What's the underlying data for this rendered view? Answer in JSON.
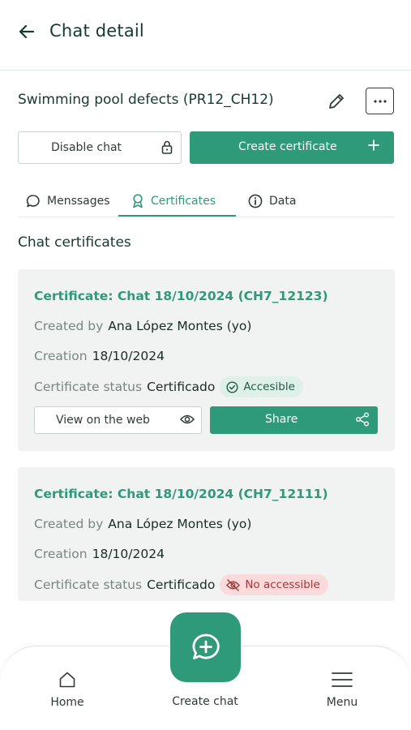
{
  "header": {
    "title": "Chat detail",
    "back_icon": "arrow-left-icon"
  },
  "chat": {
    "title": "Swimming pool defects (PR12_CH12)",
    "disable_label": "Disable chat",
    "create_certificate_label": "Create certificate"
  },
  "tabs": [
    {
      "label": "Menssages",
      "icon": "chat-bubble-icon"
    },
    {
      "label": "Certificates",
      "icon": "award-icon"
    },
    {
      "label": "Data",
      "icon": "info-icon"
    }
  ],
  "section_title": "Chat certificates",
  "certificates": [
    {
      "title": "Certificate: Chat 18/10/2024 (CH7_12123)",
      "created_by_label": "Created by",
      "created_by": "Ana López Montes (yo)",
      "creation_label": "Creation",
      "creation": "18/10/2024",
      "status_label": "Certificate status",
      "status": "Certificado",
      "access": "Accesible",
      "view_label": "View on the web",
      "share_label": "Share"
    },
    {
      "title": "Certificate: Chat 18/10/2024 (CH7_12111)",
      "created_by_label": "Created by",
      "created_by": "Ana López Montes (yo)",
      "creation_label": "Creation",
      "creation": "18/10/2024",
      "status_label": "Certificate status",
      "status": "Certificado",
      "access": "No accessible"
    }
  ],
  "bottom_nav": {
    "home": "Home",
    "create_chat": "Create chat",
    "menu": "Menu"
  },
  "colors": {
    "accent": "#2e9a7a",
    "card_bg": "#f1f3f2",
    "badge_ok_bg": "#dff0e9",
    "badge_no_bg": "#fadada"
  }
}
